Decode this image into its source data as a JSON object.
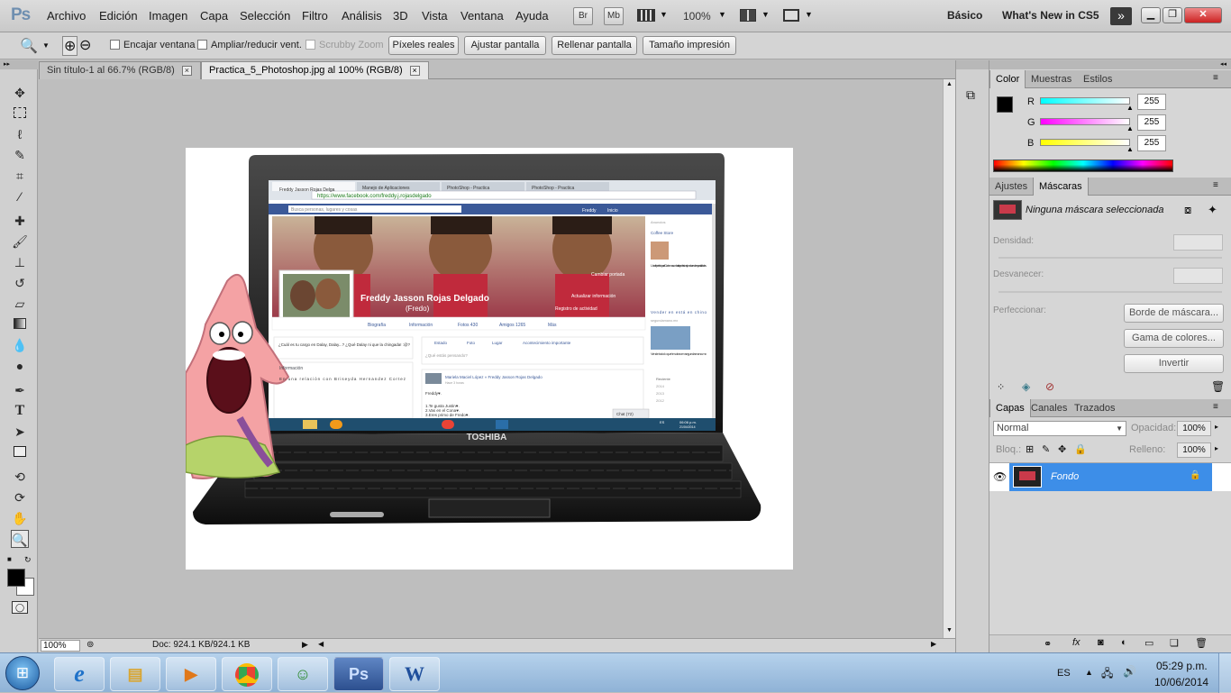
{
  "app": {
    "logo": "Ps"
  },
  "menu": [
    "Archivo",
    "Edición",
    "Imagen",
    "Capa",
    "Selección",
    "Filtro",
    "Análisis",
    "3D",
    "Vista",
    "Ventana",
    "Ayuda"
  ],
  "toolbar": {
    "bridge": "Br",
    "minibridge": "Mb",
    "zoom": "100%"
  },
  "workspace": {
    "basic": "Básico",
    "whats_new": "What's New in CS5"
  },
  "options": {
    "fit_window": "Encajar ventana",
    "resize_window": "Ampliar/reducir vent.",
    "scrubby_zoom": "Scrubby Zoom",
    "actual_pixels": "Píxeles reales",
    "fit_screen": "Ajustar pantalla",
    "fill_screen": "Rellenar pantalla",
    "print_size": "Tamaño impresión"
  },
  "tabs": [
    {
      "label": "Sin título-1 al 66.7% (RGB/8)"
    },
    {
      "label": "Practica_5_Photoshop.jpg al 100% (RGB/8)"
    }
  ],
  "status": {
    "zoom": "100%",
    "doc": "Doc: 924.1 KB/924.1 KB"
  },
  "laptop": {
    "brand": "TOSHIBA",
    "browser_tabs": [
      "Freddy Jasson Rojas Delga",
      "Manejo de Aplicaciones",
      "PhotoShop - Practica",
      "PhotoShop - Practica"
    ],
    "url": "https://www.facebook.com/freddy.j.rojasdelgado",
    "fb_search": "Busca personas, lugares y cosas",
    "fb_user": "Freddy",
    "fb_home": "Inicio",
    "profile_name": "Freddy Jasson Rojas Delgado",
    "nickname": "(Fredo)",
    "change_cover": "Cambiar portada",
    "update_info": "Actualizar información",
    "activity": "Registro de actividad",
    "profile_tabs": [
      "Biografía",
      "Información",
      "Fotos 430",
      "Amigos 1265",
      "Más"
    ],
    "post_question": "¿Cuál es tu cargo en Dalay, Dalay...? ¿Qué Dalay ni que la chingada! :@?",
    "info_title": "Información",
    "relationship": "En una relación con Briseyda Hernandez Cortez",
    "composer_items": [
      "Estado",
      "Foto",
      "Lugar",
      "Acontecimiento importante"
    ],
    "composer_placeholder": "¿Qué estás pensando?",
    "post_author": "Mariela Maciel López » Freddy Jasson Rojas Delgado",
    "post_time": "Hace 3 horas",
    "post_lines": [
      "Freddy♥.",
      "1.Te gusta Justin♥.",
      "2.Vas en el Cona♥.",
      "3.Eres primo de Fredo♥."
    ],
    "chat": "Chat (72)",
    "ads_title": "Anuncios",
    "ad1_name": "Coffee Store",
    "ad1_text": "Un café perfecto para ti. Contamos con barista profesional y una barra de especialidades.",
    "ad2_name": "Vender en está en chino",
    "ad2_site": "segundamano.mx",
    "ad2_text": "Vende todo lo que te sobra en segundamano.mx",
    "years": [
      "Reciente",
      "2014",
      "2013",
      "2012"
    ],
    "clock": "06:06 p.m.",
    "clock_date": "21/04/2014",
    "lang": "ES"
  },
  "color_panel": {
    "tabs": [
      "Color",
      "Muestras",
      "Estilos"
    ],
    "channels": [
      {
        "label": "R",
        "value": "255",
        "color": "#00ffff"
      },
      {
        "label": "G",
        "value": "255",
        "color": "#ff00ff"
      },
      {
        "label": "B",
        "value": "255",
        "color": "#ffff00"
      }
    ]
  },
  "masks_panel": {
    "tabs": [
      "Ajustes",
      "Máscaras"
    ],
    "status": "Ninguna máscara seleccionada",
    "density": "Densidad:",
    "feather": "Desvanecer:",
    "refine": "Perfeccionar:",
    "mask_edge": "Borde de máscara...",
    "color_range": "Gama de colores...",
    "invert": "Invertir"
  },
  "layers_panel": {
    "tabs": [
      "Capas",
      "Canales",
      "Trazados"
    ],
    "blend": "Normal",
    "opacity_label": "Opacidad:",
    "opacity": "100%",
    "lock_label": "Bloq.:",
    "fill_label": "Relleno:",
    "fill": "100%",
    "layer_name": "Fondo"
  },
  "taskbar": {
    "lang": "ES",
    "time": "05:29 p.m.",
    "date": "10/06/2014",
    "apps": [
      "explorer",
      "media",
      "chrome",
      "messenger",
      "photoshop",
      "word"
    ]
  }
}
